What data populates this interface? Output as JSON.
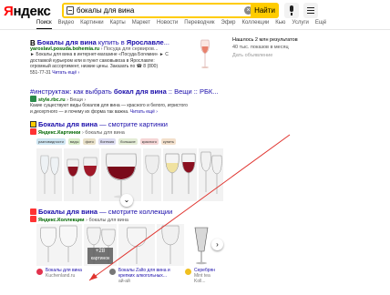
{
  "header": {
    "logo_first": "Я",
    "logo_rest": "ндекс",
    "search_value": "бокалы для вина",
    "find_label": "Найти"
  },
  "tabs": [
    "Поиск",
    "Видео",
    "Картинки",
    "Карты",
    "Маркет",
    "Новости",
    "Переводчик",
    "Эфир",
    "Коллекции",
    "Кью",
    "Услуги",
    "Ещё"
  ],
  "result1": {
    "title_a": "Бокалы для вина",
    "title_b": " купить в ",
    "title_c": "Ярославле",
    "title_d": "...",
    "url": "yaroslavl.posuda.bohemia.ru",
    "url_tail": "› Посуда для сервиров...",
    "snippet1": "► Бокалы для вина в интернет-магазине «Посуда Богемии» ► С",
    "snippet2": "доставкой курьером или в пункт самовывоза в Ярославле: ",
    "snippet3": "огромный ассортимент, низкие цены. Заказать по ☎ 8 (800)",
    "snippet4": "551-77-31",
    "snippet4_more": "Читать ещё ›"
  },
  "panel": {
    "title": "Нашлось 2 млн результатов",
    "sub": "40 тыс. показов в месяц",
    "link": "Дать объявление"
  },
  "result2": {
    "title_a": "#инструктаж: как выбрать ",
    "title_b": "бокал для вина",
    "title_c": " :: Вещи :: РБК...",
    "url": "style.rbc.ru",
    "url_tail": "› Вещи ›",
    "snippet1": "Какие существуют виды бокалов для вина — красного и белого, игристого",
    "snippet2": "и десертного — и почему их форма так важна. ",
    "snippet2_more": "Читать ещё ›"
  },
  "result3": {
    "title_a": "Бокалы для вина",
    "title_b": " — смотрите картинки",
    "url": "Яндекс.Картинки",
    "url_tail": "› бокалы для вина",
    "chips": [
      {
        "label": "разновидности",
        "color": "#cfe6f2"
      },
      {
        "label": "виды",
        "color": "#d9ecc9"
      },
      {
        "label": "фото",
        "color": "#e8e0c8"
      },
      {
        "label": "богемия",
        "color": "#dcdcf0"
      },
      {
        "label": "большие",
        "color": "#e3ecd6"
      },
      {
        "label": "красного",
        "color": "#f5d6d6"
      },
      {
        "label": "купить",
        "color": "#f3e0cc"
      }
    ]
  },
  "result4": {
    "title_a": "Бокалы для вина",
    "title_b": " — смотрите коллекции",
    "url": "Яндекс.Коллекции",
    "url_tail": "› бокалы для вина",
    "more_count": "+28",
    "more_label": "картинок"
  },
  "cards": [
    {
      "name": "Бокалы для вина",
      "source": "Kuchenland.ru"
    },
    {
      "name": "Бокалы Zalto для вина и",
      "name2": "крепких алкогольных...",
      "source": "ай-ай"
    },
    {
      "name": "Серебрян",
      "source": "Mint tea Koll..."
    }
  ],
  "colors": {
    "accent": "#ffcc00",
    "link": "#1a0dab",
    "url": "#006600",
    "annotation_arrow": "#e0332e"
  }
}
